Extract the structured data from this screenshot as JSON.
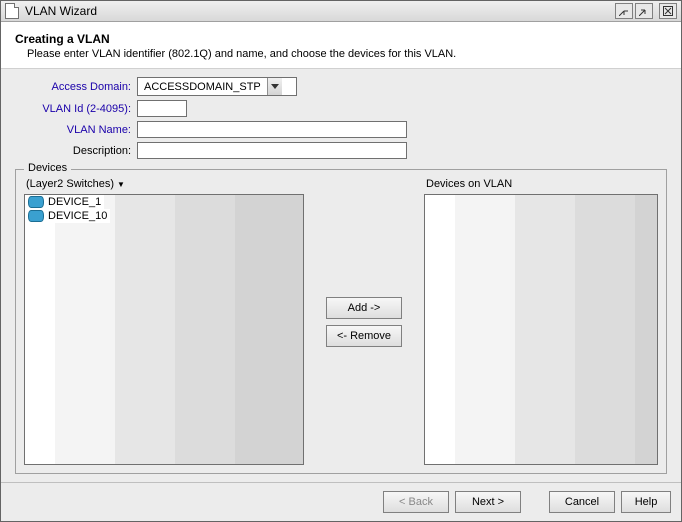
{
  "window": {
    "title": "VLAN Wizard"
  },
  "header": {
    "title": "Creating a VLAN",
    "description": "Please enter VLAN identifier (802.1Q) and name, and choose the devices for this VLAN."
  },
  "form": {
    "access_domain_label": "Access Domain:",
    "access_domain_value": "ACCESSDOMAIN_STP",
    "vlan_id_label": "VLAN Id (2-4095):",
    "vlan_id_value": "",
    "vlan_name_label": "VLAN Name:",
    "vlan_name_value": "",
    "description_label": "Description:",
    "description_value": ""
  },
  "devices": {
    "legend": "Devices",
    "filter_label": "(Layer2 Switches)",
    "right_header": "Devices on VLAN",
    "available": [
      "DEVICE_1",
      "DEVICE_10"
    ],
    "on_vlan": [],
    "add_label": "Add ->",
    "remove_label": "<- Remove"
  },
  "footer": {
    "back": "< Back",
    "next": "Next >",
    "cancel": "Cancel",
    "help": "Help"
  }
}
